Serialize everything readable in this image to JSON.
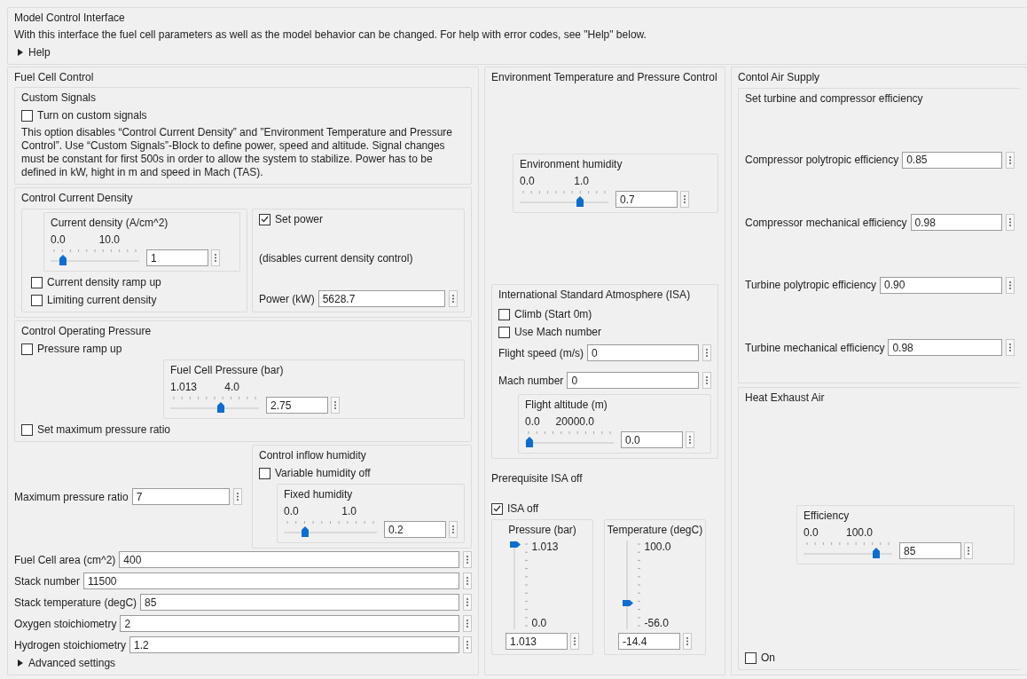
{
  "header": {
    "title": "Model Control Interface",
    "description": "With this interface the fuel cell parameters  as well as the model behavior can be changed. For help with error codes, see \"Help\" below.",
    "help": {
      "label": "Help",
      "expanded": false
    }
  },
  "fuel_cell_control": {
    "title": "Fuel Cell Control",
    "custom_signals": {
      "title": "Custom Signals",
      "checkbox": {
        "label": "Turn on custom signals",
        "checked": false
      },
      "note": "This option disables “Control Current Density” and ”Environment Temperature and Pressure Control”. Use “Custom Signals”-Block to define power, speed and altitude. Signal changes must be constant for first 500s  in order to allow the system to stabilize. Power has to be defined in kW, hight in m and speed in Mach (TAS)."
    },
    "current_density": {
      "title": "Control Current Density",
      "slider": {
        "title": "Current density (A/cm^2)",
        "min": "0.0",
        "max": "10.0",
        "level": 0.1,
        "value": "1"
      },
      "checkboxes": [
        {
          "label": "Current density ramp up",
          "checked": false
        },
        {
          "label": "Limiting current density",
          "checked": false
        }
      ],
      "set_power": {
        "label": "Set power",
        "checked": true
      },
      "note": "(disables current density control)",
      "power": {
        "label": "Power (kW)",
        "value": "5628.7"
      }
    },
    "operating_pressure": {
      "title": "Control Operating Pressure",
      "ramp": {
        "label": "Pressure ramp up",
        "checked": false
      },
      "slider": {
        "title": "Fuel Cell Pressure (bar)",
        "min": "1.013",
        "max": "4.0",
        "level": 0.58,
        "value": "2.75"
      },
      "max_ratio": {
        "label": "Set maximum pressure ratio",
        "checked": false
      }
    },
    "max_ratio_field": {
      "label": "Maximum pressure ratio",
      "value": "7"
    },
    "inflow_humidity": {
      "title": "Control inflow humidity",
      "checkbox": {
        "label": "Variable humidity off",
        "checked": false
      },
      "slider": {
        "title": "Fixed humidity",
        "min": "0.0",
        "max": "1.0",
        "level": 0.2,
        "value": "0.2"
      }
    },
    "fields": [
      {
        "label": "Fuel Cell area (cm^2)",
        "value": "400"
      },
      {
        "label": "Stack number",
        "value": "11500"
      },
      {
        "label": "Stack temperature (degC)",
        "value": "85"
      },
      {
        "label": "Oxygen stoichiometry",
        "value": "2"
      },
      {
        "label": "Hydrogen stoichiometry",
        "value": "1.2"
      }
    ],
    "advanced": {
      "label": "Advanced settings",
      "expanded": false
    }
  },
  "environment": {
    "title": "Environment Temperature and Pressure Control",
    "humidity": {
      "title": "Environment humidity",
      "min": "0.0",
      "max": "1.0",
      "level": 0.7,
      "value": "0.7"
    },
    "isa": {
      "title": "International Standard Atmosphere (ISA)",
      "checkboxes": [
        {
          "label": "Climb (Start 0m)",
          "checked": false
        },
        {
          "label": "Use Mach number",
          "checked": false
        }
      ],
      "fields": [
        {
          "label": "Flight speed (m/s)",
          "value": "0"
        },
        {
          "label": "Mach number",
          "value": "0"
        }
      ],
      "altitude": {
        "title": "Flight altitude (m)",
        "min": "0.0",
        "max": "20000.0",
        "level": 0,
        "value": "0.0"
      }
    },
    "prerequisite": {
      "title": "Prerequisite ISA off",
      "checkbox": {
        "label": "ISA off",
        "checked": true
      },
      "sliders": [
        {
          "title": "Pressure (bar)",
          "max": "1.013",
          "min": "0.0",
          "level": 1,
          "value": "1.013"
        },
        {
          "title": "Temperature (degC)",
          "max": "100.0",
          "min": "-56.0",
          "level": 0.27,
          "value": "-14.4"
        }
      ]
    }
  },
  "air_supply": {
    "title": "Contol Air Supply",
    "efficiency": {
      "title": "Set turbine and compressor efficiency",
      "fields": [
        {
          "label": "Compressor polytropic efficiency",
          "value": "0.85"
        },
        {
          "label": "Compressor mechanical efficiency",
          "value": "0.98"
        },
        {
          "label": "Turbine polytropic efficiency",
          "value": "0.90"
        },
        {
          "label": "Turbine mechanical efficiency",
          "value": "0.98"
        }
      ]
    },
    "heat_exhaust": {
      "title": "Heat Exhaust Air",
      "slider": {
        "title": "Efficiency",
        "min": "0.0",
        "max": "100.0",
        "level": 0.85,
        "value": "85"
      },
      "checkbox": {
        "label": "On",
        "checked": false
      }
    }
  }
}
